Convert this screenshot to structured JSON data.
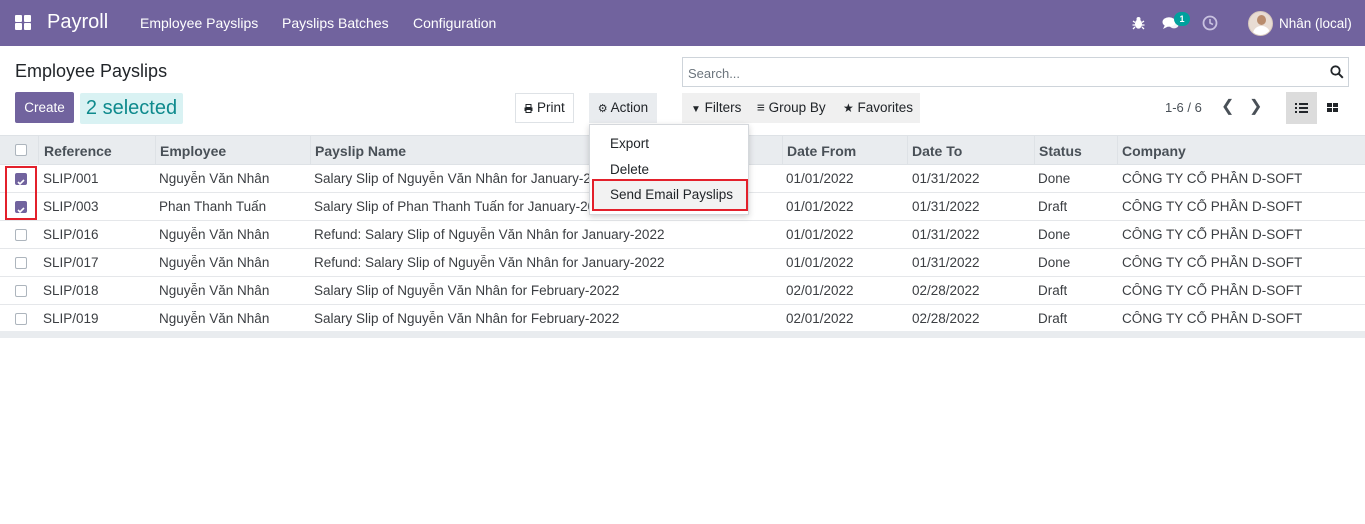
{
  "navbar": {
    "brand": "Payroll",
    "menu": [
      "Employee Payslips",
      "Payslips Batches",
      "Configuration"
    ],
    "message_count": "1",
    "user_name": "Nhân (local)"
  },
  "control_panel": {
    "title": "Employee Payslips",
    "create_label": "Create",
    "selected_label": "2 selected",
    "print_label": "Print",
    "action_label": "Action",
    "search_placeholder": "Search...",
    "filters_label": "Filters",
    "group_by_label": "Group By",
    "favorites_label": "Favorites",
    "pager": "1-6 / 6"
  },
  "action_menu": {
    "items": [
      "Export",
      "Delete",
      "Send Email Payslips"
    ],
    "highlighted": "Send Email Payslips"
  },
  "table": {
    "columns": [
      "Reference",
      "Employee",
      "Payslip Name",
      "Date From",
      "Date To",
      "Status",
      "Company"
    ],
    "rows": [
      {
        "checked": true,
        "reference": "SLIP/001",
        "employee": "Nguyễn Văn Nhân",
        "name": "Salary Slip of Nguyễn Văn Nhân for January-2022",
        "date_from": "01/01/2022",
        "date_to": "01/31/2022",
        "status": "Done",
        "company": "CÔNG TY CỔ PHẦN D-SOFT"
      },
      {
        "checked": true,
        "reference": "SLIP/003",
        "employee": "Phan Thanh Tuấn",
        "name": "Salary Slip of Phan Thanh Tuấn for January-2022",
        "date_from": "01/01/2022",
        "date_to": "01/31/2022",
        "status": "Draft",
        "company": "CÔNG TY CỔ PHẦN D-SOFT"
      },
      {
        "checked": false,
        "reference": "SLIP/016",
        "employee": "Nguyễn Văn Nhân",
        "name": "Refund: Salary Slip of Nguyễn Văn Nhân for January-2022",
        "date_from": "01/01/2022",
        "date_to": "01/31/2022",
        "status": "Done",
        "company": "CÔNG TY CỔ PHẦN D-SOFT"
      },
      {
        "checked": false,
        "reference": "SLIP/017",
        "employee": "Nguyễn Văn Nhân",
        "name": "Refund: Salary Slip of Nguyễn Văn Nhân for January-2022",
        "date_from": "01/01/2022",
        "date_to": "01/31/2022",
        "status": "Done",
        "company": "CÔNG TY CỔ PHẦN D-SOFT"
      },
      {
        "checked": false,
        "reference": "SLIP/018",
        "employee": "Nguyễn Văn Nhân",
        "name": "Salary Slip of Nguyễn Văn Nhân for February-2022",
        "date_from": "02/01/2022",
        "date_to": "02/28/2022",
        "status": "Draft",
        "company": "CÔNG TY CỔ PHẦN D-SOFT"
      },
      {
        "checked": false,
        "reference": "SLIP/019",
        "employee": "Nguyễn Văn Nhân",
        "name": "Salary Slip of Nguyễn Văn Nhân for February-2022",
        "date_from": "02/01/2022",
        "date_to": "02/28/2022",
        "status": "Draft",
        "company": "CÔNG TY CỔ PHẦN D-SOFT"
      }
    ]
  },
  "colors": {
    "brand": "#71639e",
    "selected_bg": "#d9f2f3",
    "annotation": "#e3202b"
  },
  "icons": [
    "apps-grid-icon",
    "bug-icon",
    "chat-icon",
    "clock-icon",
    "print-icon",
    "gear-icon",
    "search-icon",
    "filter-icon",
    "group-by-icon",
    "star-icon",
    "chevron-left-icon",
    "chevron-right-icon",
    "list-view-icon",
    "kanban-view-icon"
  ]
}
